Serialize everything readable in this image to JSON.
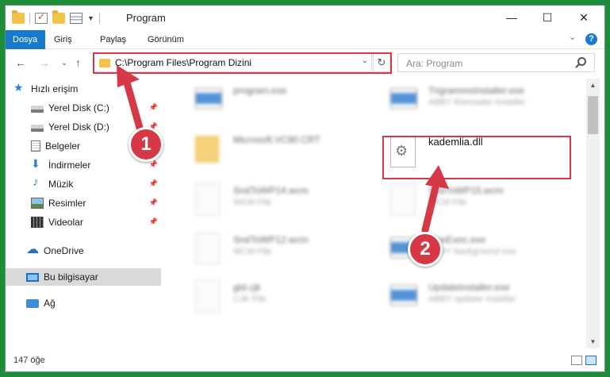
{
  "window": {
    "title": "Program",
    "minimize": "—",
    "maximize": "☐",
    "close": "✕"
  },
  "ribbon": {
    "tabs": [
      "Dosya",
      "Giriş",
      "Paylaş",
      "Görünüm"
    ],
    "expand": "⌄",
    "help": "?"
  },
  "nav": {
    "back": "←",
    "forward": "→",
    "recent": "⌄",
    "up": "↑",
    "address": "C:\\Program Files\\Program Dizini",
    "address_drop": "⌄",
    "refresh": "↻",
    "search_placeholder": "Ara: Program"
  },
  "sidebar": {
    "items": [
      {
        "label": "Hızlı erişim",
        "icon": "star-icon"
      },
      {
        "label": "Yerel Disk (C:)",
        "icon": "disk-icon"
      },
      {
        "label": "Yerel Disk (D:)",
        "icon": "disk-icon"
      },
      {
        "label": "Belgeler",
        "icon": "documents-icon"
      },
      {
        "label": "İndirmeler",
        "icon": "downloads-icon"
      },
      {
        "label": "Müzik",
        "icon": "music-icon"
      },
      {
        "label": "Resimler",
        "icon": "pictures-icon"
      },
      {
        "label": "Videolar",
        "icon": "videos-icon"
      },
      {
        "label": "OneDrive",
        "icon": "cloud-icon"
      },
      {
        "label": "Bu bilgisayar",
        "icon": "computer-icon"
      },
      {
        "label": "Ağ",
        "icon": "network-icon"
      }
    ]
  },
  "files": [
    {
      "name": "program.exe",
      "sub": ""
    },
    {
      "name": "TrigrammsInstaller.exe",
      "sub": "ABBY finemader Installer"
    },
    {
      "name": "Microsoft.VC90.CRT",
      "sub": ""
    },
    {
      "name": "kademlia.dll",
      "sub": ""
    },
    {
      "name": "SndToWP14.wcm",
      "sub": "WCM File"
    },
    {
      "name": "SndToWP15.wcm",
      "sub": "WCM File"
    },
    {
      "name": "SndToWP12.wcm",
      "sub": "WCM File"
    },
    {
      "name": "OneExec.exe",
      "sub": "ABBY background exe"
    },
    {
      "name": "gtd.cjk",
      "sub": "CJK File"
    },
    {
      "name": "UpdateInstaller.exe",
      "sub": "ABBY updater installer"
    }
  ],
  "status": {
    "count": "147 öğe"
  },
  "callouts": [
    "1",
    "2"
  ],
  "colors": {
    "accent": "#1979ca",
    "highlight": "#d63946",
    "background": "#1e8c3a"
  }
}
